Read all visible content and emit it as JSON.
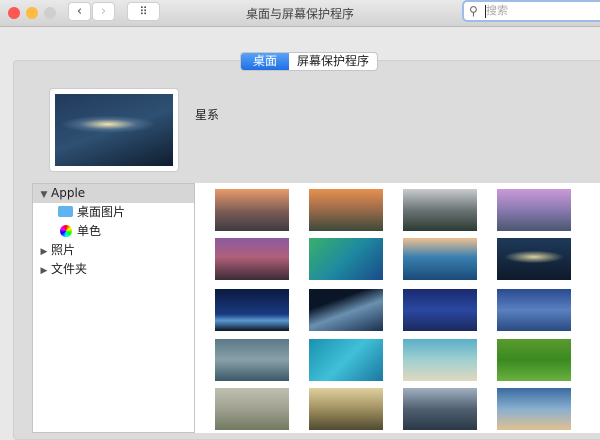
{
  "window": {
    "title": "桌面与屏幕保护程序"
  },
  "toolbar": {
    "back": "‹",
    "forward": "›",
    "grid": "⠿",
    "search_placeholder": "搜索"
  },
  "tabs": [
    {
      "label": "桌面"
    },
    {
      "label": "屏幕保护程序"
    }
  ],
  "current": {
    "name": "星系"
  },
  "sidebar": {
    "items": [
      {
        "label": "Apple"
      },
      {
        "label": "桌面图片"
      },
      {
        "label": "单色"
      },
      {
        "label": "照片"
      },
      {
        "label": "文件夹"
      }
    ]
  },
  "colors": {
    "accent": "#1e6fe6",
    "close": "#fc5753",
    "minimize": "#fdbc40",
    "disabled": "#cfcfcf"
  }
}
